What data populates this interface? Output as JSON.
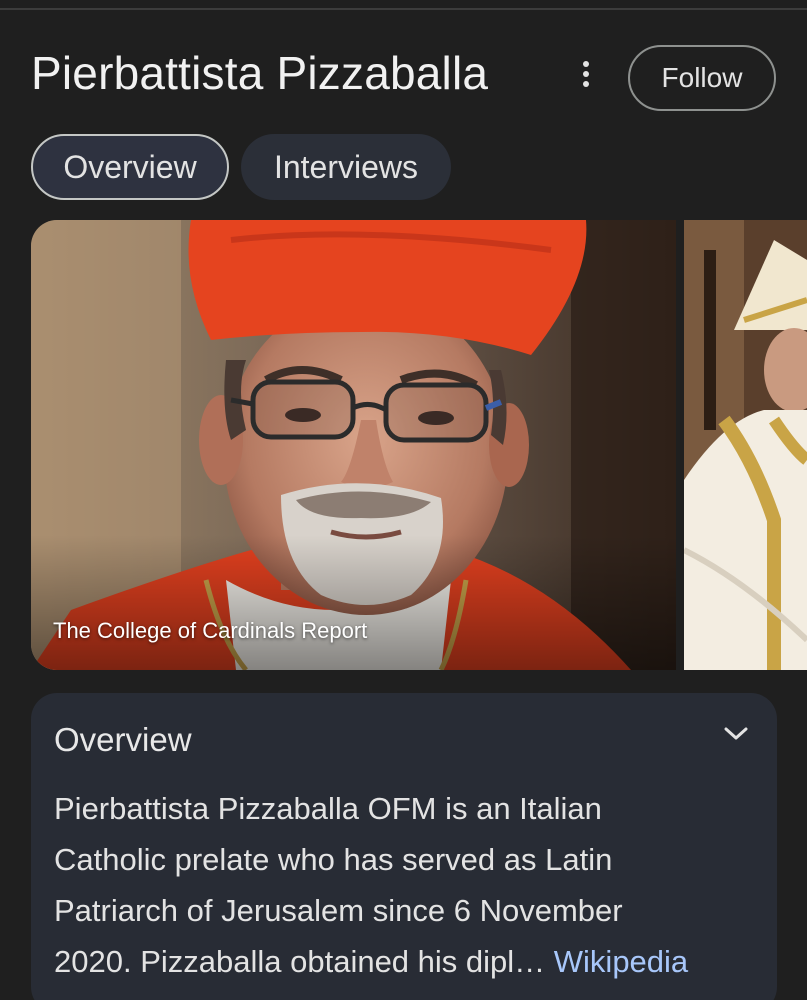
{
  "header": {
    "title": "Pierbattista Pizzaballa",
    "more_icon": "more-vert-icon",
    "follow_label": "Follow"
  },
  "tabs": [
    {
      "label": "Overview",
      "selected": true
    },
    {
      "label": "Interviews",
      "selected": false
    }
  ],
  "images": {
    "main_caption": "The College of Cardinals Report"
  },
  "overview_card": {
    "title": "Overview",
    "expand_icon": "chevron-down-icon",
    "lines": [
      "Pierbattista Pizzaballa OFM is an Italian",
      "Catholic prelate who has served as Latin",
      "Patriarch of Jerusalem since 6 November",
      "2020. Pizzaballa obtained his dipl…"
    ],
    "source_label": "Wikipedia"
  },
  "colors": {
    "background": "#1f1f1f",
    "card": "#282c35",
    "link": "#a8c7fa",
    "cardinal_red": "#e8401c"
  }
}
